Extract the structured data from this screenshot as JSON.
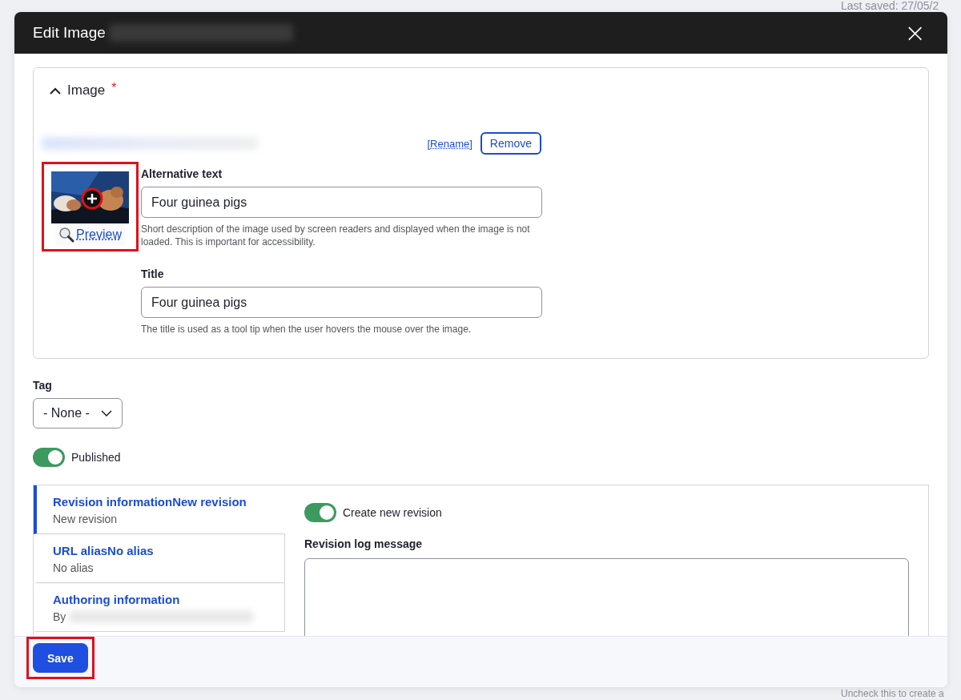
{
  "background": {
    "last_saved": "Last saved: 27/05/2",
    "hint": "Uncheck this to create a"
  },
  "dialog": {
    "title": "Edit Image",
    "close": "×"
  },
  "image_field": {
    "label": "Image",
    "required_mark": "*",
    "expanded": true,
    "rename_link": "[Rename]",
    "remove_button": "Remove",
    "preview_link": "Preview",
    "highlighted": true,
    "fields": [
      {
        "label": "Alternative text",
        "value": "Four guinea pigs",
        "description": "Short description of the image used by screen readers and displayed when the image is not loaded. This is important for accessibility."
      },
      {
        "label": "Title",
        "value": "Four guinea pigs",
        "description": "The title is used as a tool tip when the user hovers the mouse over the image."
      }
    ]
  },
  "tag": {
    "label": "Tag",
    "value": "- None -"
  },
  "published": {
    "label": "Published",
    "on": true
  },
  "vertical_tabs": [
    {
      "title": "Revision informationNew revision",
      "summary": "New revision",
      "selected": true
    },
    {
      "title": "URL aliasNo alias",
      "summary": "No alias",
      "selected": false
    },
    {
      "title": "Authoring information",
      "summary": "By",
      "selected": false
    }
  ],
  "revision": {
    "toggle": {
      "label": "Create new revision",
      "on": true
    },
    "log_label": "Revision log message"
  },
  "footer": {
    "save_button": "Save",
    "highlighted": true
  }
}
